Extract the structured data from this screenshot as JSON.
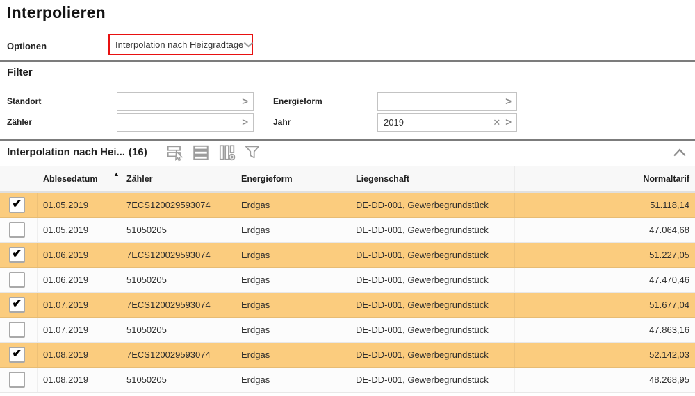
{
  "page": {
    "title": "Interpolieren"
  },
  "options": {
    "label": "Optionen",
    "value": "Interpolation nach Heizgradtage"
  },
  "filter": {
    "title": "Filter",
    "fields": [
      {
        "id": "standort",
        "label": "Standort",
        "value": ""
      },
      {
        "id": "energieform",
        "label": "Energieform",
        "value": ""
      },
      {
        "id": "zaehler",
        "label": "Zähler",
        "value": ""
      },
      {
        "id": "jahr",
        "label": "Jahr",
        "value": "2019"
      }
    ]
  },
  "table": {
    "title": "Interpolation nach Hei...",
    "count": "(16)",
    "toolbar_icons": [
      "multi-select-icon",
      "table-rows-icon",
      "column-settings-icon",
      "filter-icon"
    ],
    "collapse_icon": "chevron-up-icon",
    "sort": {
      "column": "Ablesedatum",
      "direction": "ascending"
    },
    "columns": [
      "Ablesedatum",
      "Zähler",
      "Energieform",
      "Liegenschaft",
      "Normaltarif"
    ],
    "rows": [
      {
        "selected": true,
        "ablesedatum": "01.05.2019",
        "zaehler": "7ECS120029593074",
        "energieform": "Erdgas",
        "liegenschaft": "DE-DD-001, Gewerbegrundstück",
        "normaltarif": "51.118,14"
      },
      {
        "selected": false,
        "ablesedatum": "01.05.2019",
        "zaehler": "51050205",
        "energieform": "Erdgas",
        "liegenschaft": "DE-DD-001, Gewerbegrundstück",
        "normaltarif": "47.064,68"
      },
      {
        "selected": true,
        "ablesedatum": "01.06.2019",
        "zaehler": "7ECS120029593074",
        "energieform": "Erdgas",
        "liegenschaft": "DE-DD-001, Gewerbegrundstück",
        "normaltarif": "51.227,05"
      },
      {
        "selected": false,
        "ablesedatum": "01.06.2019",
        "zaehler": "51050205",
        "energieform": "Erdgas",
        "liegenschaft": "DE-DD-001, Gewerbegrundstück",
        "normaltarif": "47.470,46"
      },
      {
        "selected": true,
        "ablesedatum": "01.07.2019",
        "zaehler": "7ECS120029593074",
        "energieform": "Erdgas",
        "liegenschaft": "DE-DD-001, Gewerbegrundstück",
        "normaltarif": "51.677,04"
      },
      {
        "selected": false,
        "ablesedatum": "01.07.2019",
        "zaehler": "51050205",
        "energieform": "Erdgas",
        "liegenschaft": "DE-DD-001, Gewerbegrundstück",
        "normaltarif": "47.863,16"
      },
      {
        "selected": true,
        "ablesedatum": "01.08.2019",
        "zaehler": "7ECS120029593074",
        "energieform": "Erdgas",
        "liegenschaft": "DE-DD-001, Gewerbegrundstück",
        "normaltarif": "52.142,03"
      },
      {
        "selected": false,
        "ablesedatum": "01.08.2019",
        "zaehler": "51050205",
        "energieform": "Erdgas",
        "liegenschaft": "DE-DD-001, Gewerbegrundstück",
        "normaltarif": "48.268,95"
      }
    ]
  },
  "colors": {
    "selected_row": "#fbcc7e",
    "highlight_border": "#e81111",
    "icon_gray": "#9c9c9c",
    "header_bg": "#f8f8f8"
  }
}
